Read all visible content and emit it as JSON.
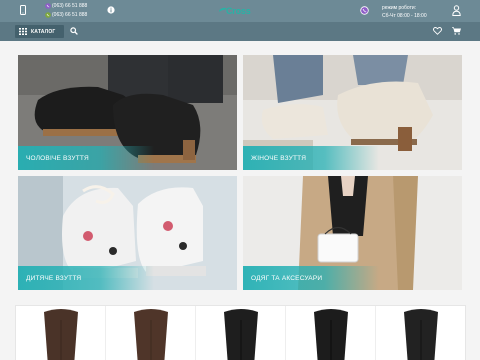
{
  "header": {
    "phone_1": "(063) 66 51 888",
    "phone_2": "(063) 66 51 888",
    "logo": "Cross",
    "schedule_title": "режим роботи:",
    "schedule_hours": "Сб-Чт 08:00 - 18:00"
  },
  "nav": {
    "catalog_label": "КАТАЛОГ"
  },
  "categories": [
    {
      "label": "ЧОЛОВІЧЕ ВЗУТТЯ"
    },
    {
      "label": "ЖІНОЧЕ ВЗУТТЯ"
    },
    {
      "label": "ДИТЯЧЕ ВЗУТТЯ"
    },
    {
      "label": "ОДЯГ ТА АКСЕСУАРИ"
    }
  ],
  "colors": {
    "accent": "#27b3a6",
    "topbar": "#6d8a96",
    "navbar": "#5c7884",
    "label_gradient": "#25b0b4"
  },
  "icons": [
    "phone-icon",
    "viber-icon",
    "info-icon",
    "viber-icon",
    "user-icon",
    "grid-icon",
    "search-icon",
    "heart-icon",
    "cart-icon"
  ]
}
